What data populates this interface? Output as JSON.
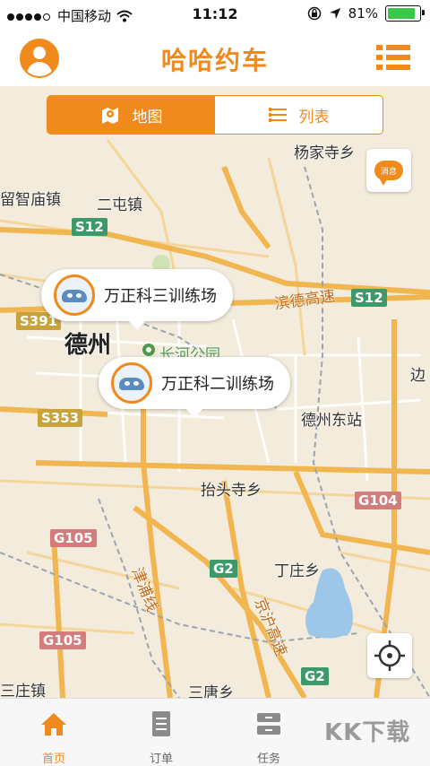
{
  "status_bar": {
    "carrier": "中国移动",
    "time": "11:12",
    "battery": "81%",
    "signal_bars_filled": 4,
    "battery_level": 0.81
  },
  "header": {
    "title": "哈哈约车",
    "avatar_icon": "user-icon",
    "menu_icon": "list-menu-icon"
  },
  "view_toggle": {
    "map_label": "地图",
    "list_label": "列表",
    "selected": "map"
  },
  "message_button": {
    "label": "消息"
  },
  "map": {
    "place_labels": {
      "yangjiasi": "杨家寺乡",
      "liuzhimiao": "留智庙镇",
      "ertun": "二屯镇",
      "dezhou": "德州",
      "changhe_park": "长河公园",
      "dezhou_east": "德州东站",
      "taitousi": "抬头寺乡",
      "dingzhuang": "丁庄乡",
      "jinpu": "津浦线",
      "jinghu": "京沪高速",
      "binde": "滨德高速",
      "sanzhuang": "三庄镇",
      "santang": "三唐乡",
      "bian": "边"
    },
    "road_shields": {
      "s12_left": "S12",
      "s12_right": "S12",
      "s391": "S391",
      "s353": "S353",
      "g104": "G104",
      "g105_top": "G105",
      "g105_bottom": "G105",
      "g2_top": "G2",
      "g2_bottom": "G2"
    },
    "markers": [
      {
        "name": "万正科三训练场"
      },
      {
        "name": "万正科二训练场"
      }
    ]
  },
  "tab_bar": {
    "tabs": [
      {
        "label": "首页",
        "icon": "home-icon",
        "active": true
      },
      {
        "label": "订单",
        "icon": "order-icon",
        "active": false
      },
      {
        "label": "任务",
        "icon": "task-icon",
        "active": false
      }
    ]
  },
  "watermark": "KK下载",
  "colors": {
    "accent": "#f08a1d",
    "map_background": "#f3ecdc",
    "major_road": "#f2b650"
  }
}
